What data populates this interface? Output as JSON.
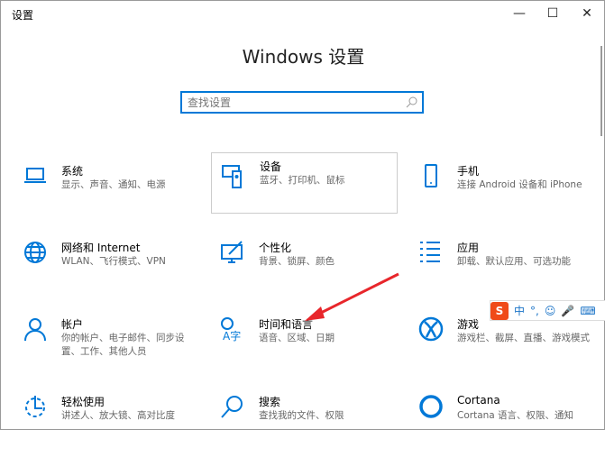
{
  "window": {
    "title": "设置",
    "minimize": "—",
    "maximize": "☐",
    "close": "✕"
  },
  "heading": "Windows 设置",
  "search": {
    "placeholder": "查找设置",
    "icon": "search-icon"
  },
  "tiles": [
    {
      "title": "系统",
      "desc": "显示、声音、通知、电源",
      "icon": "laptop-icon"
    },
    {
      "title": "设备",
      "desc": "蓝牙、打印机、鼠标",
      "icon": "devices-icon"
    },
    {
      "title": "手机",
      "desc": "连接 Android 设备和 iPhone",
      "icon": "phone-icon"
    },
    {
      "title": "网络和 Internet",
      "desc": "WLAN、飞行模式、VPN",
      "icon": "globe-icon"
    },
    {
      "title": "个性化",
      "desc": "背景、锁屏、颜色",
      "icon": "personalization-icon"
    },
    {
      "title": "应用",
      "desc": "卸载、默认应用、可选功能",
      "icon": "apps-icon"
    },
    {
      "title": "帐户",
      "desc": "你的帐户、电子邮件、同步设置、工作、其他人员",
      "icon": "person-icon"
    },
    {
      "title": "时间和语言",
      "desc": "语音、区域、日期",
      "icon": "time-language-icon"
    },
    {
      "title": "游戏",
      "desc": "游戏栏、截屏、直播、游戏模式",
      "icon": "xbox-icon"
    },
    {
      "title": "轻松使用",
      "desc": "讲述人、放大镜、高对比度",
      "icon": "ease-of-access-icon"
    },
    {
      "title": "搜索",
      "desc": "查找我的文件、权限",
      "icon": "search-icon"
    },
    {
      "title": "Cortana",
      "desc": "Cortana 语言、权限、通知",
      "icon": "cortana-icon"
    }
  ],
  "ime": {
    "logo": "S",
    "mode": "中",
    "punct": "°,"
  },
  "accent": "#0078d7"
}
